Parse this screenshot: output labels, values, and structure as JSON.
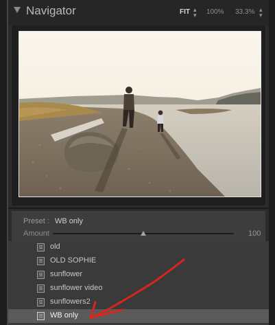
{
  "navigator": {
    "title": "Navigator",
    "zoom_fit": "FIT",
    "zoom_100": "100%",
    "zoom_custom": "33.3%"
  },
  "preview": {
    "description_icon": "photo-preview"
  },
  "preset_panel": {
    "preset_label": "Preset :",
    "preset_value": "WB only",
    "amount_label": "Amount",
    "amount_value": "100",
    "amount_fraction": 0.5
  },
  "presets_list": [
    {
      "label": "old"
    },
    {
      "label": "OLD SOPHIE"
    },
    {
      "label": "sunflower"
    },
    {
      "label": "sunflower video"
    },
    {
      "label": "sunflowers2"
    },
    {
      "label": "WB only",
      "selected": true
    }
  ],
  "colors": {
    "annotation_red": "#d9261c",
    "panel_dark": "#2b2b2b",
    "selection": "#5a5a5a"
  }
}
